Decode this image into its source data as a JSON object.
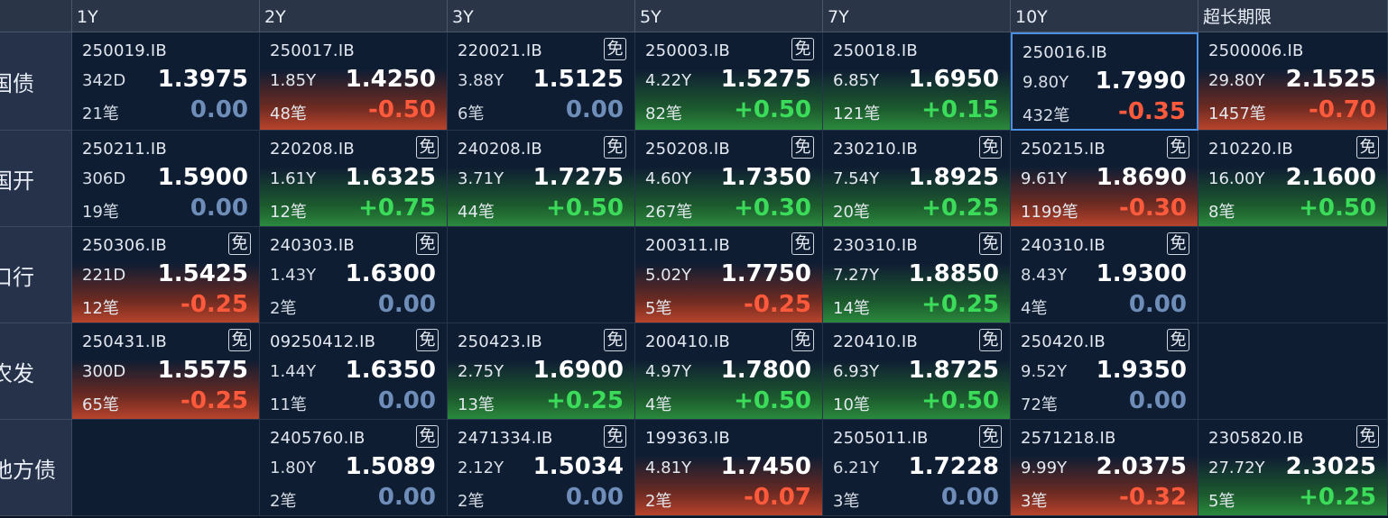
{
  "columns": [
    "1Y",
    "2Y",
    "3Y",
    "5Y",
    "7Y",
    "10Y",
    "超长期限"
  ],
  "rows": [
    {
      "label": "国债",
      "cells": [
        {
          "code": "250019.IB",
          "badge": "",
          "term": "342D",
          "yield": "1.3975",
          "trades": "21笔",
          "change": "0.00",
          "trend": "flat"
        },
        {
          "code": "250017.IB",
          "badge": "",
          "term": "1.85Y",
          "yield": "1.4250",
          "trades": "48笔",
          "change": "-0.50",
          "trend": "down"
        },
        {
          "code": "220021.IB",
          "badge": "免",
          "term": "3.88Y",
          "yield": "1.5125",
          "trades": "6笔",
          "change": "0.00",
          "trend": "flat"
        },
        {
          "code": "250003.IB",
          "badge": "免",
          "term": "4.22Y",
          "yield": "1.5275",
          "trades": "82笔",
          "change": "+0.50",
          "trend": "up"
        },
        {
          "code": "250018.IB",
          "badge": "",
          "term": "6.85Y",
          "yield": "1.6950",
          "trades": "121笔",
          "change": "+0.15",
          "trend": "up"
        },
        {
          "code": "250016.IB",
          "badge": "",
          "term": "9.80Y",
          "yield": "1.7990",
          "trades": "432笔",
          "change": "-0.35",
          "trend": "flat",
          "selected": true
        },
        {
          "code": "2500006.IB",
          "badge": "",
          "term": "29.80Y",
          "yield": "2.1525",
          "trades": "1457笔",
          "change": "-0.70",
          "trend": "down"
        }
      ]
    },
    {
      "label": "国开",
      "cells": [
        {
          "code": "250211.IB",
          "badge": "",
          "term": "306D",
          "yield": "1.5900",
          "trades": "19笔",
          "change": "0.00",
          "trend": "flat"
        },
        {
          "code": "220208.IB",
          "badge": "免",
          "term": "1.61Y",
          "yield": "1.6325",
          "trades": "12笔",
          "change": "+0.75",
          "trend": "up"
        },
        {
          "code": "240208.IB",
          "badge": "免",
          "term": "3.71Y",
          "yield": "1.7275",
          "trades": "44笔",
          "change": "+0.50",
          "trend": "up"
        },
        {
          "code": "250208.IB",
          "badge": "免",
          "term": "4.60Y",
          "yield": "1.7350",
          "trades": "267笔",
          "change": "+0.30",
          "trend": "up"
        },
        {
          "code": "230210.IB",
          "badge": "免",
          "term": "7.54Y",
          "yield": "1.8925",
          "trades": "20笔",
          "change": "+0.25",
          "trend": "up"
        },
        {
          "code": "250215.IB",
          "badge": "免",
          "term": "9.61Y",
          "yield": "1.8690",
          "trades": "1199笔",
          "change": "-0.30",
          "trend": "down"
        },
        {
          "code": "210220.IB",
          "badge": "免",
          "term": "16.00Y",
          "yield": "2.1600",
          "trades": "8笔",
          "change": "+0.50",
          "trend": "up"
        }
      ]
    },
    {
      "label": "口行",
      "cells": [
        {
          "code": "250306.IB",
          "badge": "免",
          "term": "221D",
          "yield": "1.5425",
          "trades": "12笔",
          "change": "-0.25",
          "trend": "down"
        },
        {
          "code": "240303.IB",
          "badge": "免",
          "term": "1.43Y",
          "yield": "1.6300",
          "trades": "2笔",
          "change": "0.00",
          "trend": "flat"
        },
        null,
        {
          "code": "200311.IB",
          "badge": "免",
          "term": "5.02Y",
          "yield": "1.7750",
          "trades": "5笔",
          "change": "-0.25",
          "trend": "down"
        },
        {
          "code": "230310.IB",
          "badge": "免",
          "term": "7.27Y",
          "yield": "1.8850",
          "trades": "14笔",
          "change": "+0.25",
          "trend": "up"
        },
        {
          "code": "240310.IB",
          "badge": "免",
          "term": "8.43Y",
          "yield": "1.9300",
          "trades": "4笔",
          "change": "0.00",
          "trend": "flat"
        },
        null
      ]
    },
    {
      "label": "农发",
      "cells": [
        {
          "code": "250431.IB",
          "badge": "免",
          "term": "300D",
          "yield": "1.5575",
          "trades": "65笔",
          "change": "-0.25",
          "trend": "down"
        },
        {
          "code": "09250412.IB",
          "badge": "免",
          "term": "1.44Y",
          "yield": "1.6350",
          "trades": "11笔",
          "change": "0.00",
          "trend": "flat"
        },
        {
          "code": "250423.IB",
          "badge": "免",
          "term": "2.75Y",
          "yield": "1.6900",
          "trades": "13笔",
          "change": "+0.25",
          "trend": "up"
        },
        {
          "code": "200410.IB",
          "badge": "免",
          "term": "4.97Y",
          "yield": "1.7800",
          "trades": "4笔",
          "change": "+0.50",
          "trend": "up"
        },
        {
          "code": "220410.IB",
          "badge": "免",
          "term": "6.93Y",
          "yield": "1.8725",
          "trades": "10笔",
          "change": "+0.50",
          "trend": "up"
        },
        {
          "code": "250420.IB",
          "badge": "免",
          "term": "9.52Y",
          "yield": "1.9350",
          "trades": "72笔",
          "change": "0.00",
          "trend": "flat"
        },
        null
      ]
    },
    {
      "label": "地方债",
      "cells": [
        null,
        {
          "code": "2405760.IB",
          "badge": "免",
          "term": "1.80Y",
          "yield": "1.5089",
          "trades": "2笔",
          "change": "0.00",
          "trend": "flat"
        },
        {
          "code": "2471334.IB",
          "badge": "免",
          "term": "2.12Y",
          "yield": "1.5034",
          "trades": "2笔",
          "change": "0.00",
          "trend": "flat"
        },
        {
          "code": "199363.IB",
          "badge": "",
          "term": "4.81Y",
          "yield": "1.7450",
          "trades": "2笔",
          "change": "-0.07",
          "trend": "down"
        },
        {
          "code": "2505011.IB",
          "badge": "免",
          "term": "6.21Y",
          "yield": "1.7228",
          "trades": "3笔",
          "change": "0.00",
          "trend": "flat"
        },
        {
          "code": "2571218.IB",
          "badge": "",
          "term": "9.99Y",
          "yield": "2.0375",
          "trades": "3笔",
          "change": "-0.32",
          "trend": "down"
        },
        {
          "code": "2305820.IB",
          "badge": "免",
          "term": "27.72Y",
          "yield": "2.3025",
          "trades": "5笔",
          "change": "+0.25",
          "trend": "up"
        }
      ]
    }
  ],
  "colors": {
    "up": "#3bdc5a",
    "down": "#ff5a3c",
    "flat": "#6e8db8",
    "selected_border": "#4a90e2"
  }
}
